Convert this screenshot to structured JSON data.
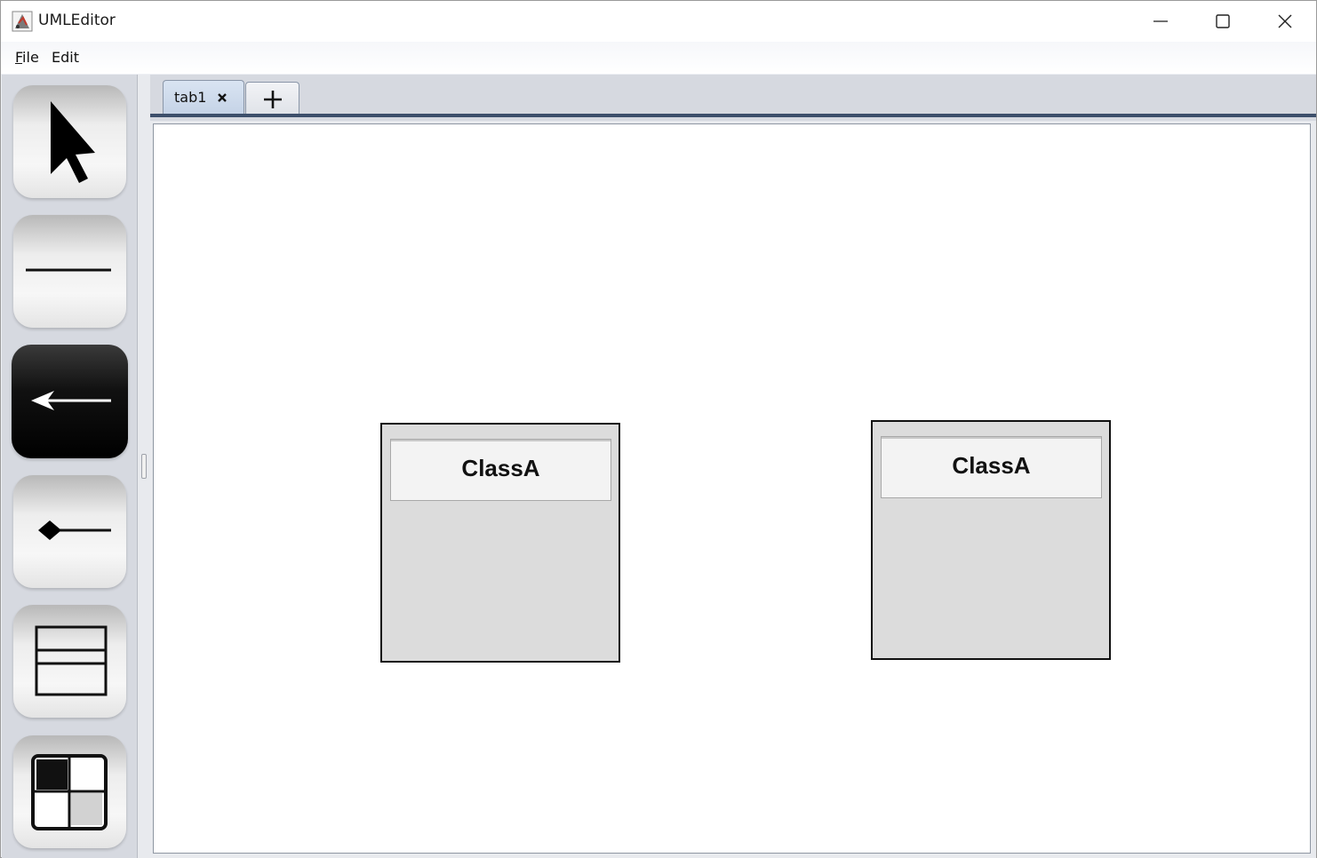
{
  "window": {
    "title": "UMLEditor",
    "controls": [
      {
        "name": "minimize-button",
        "icon": "minimize-icon"
      },
      {
        "name": "maximize-button",
        "icon": "maximize-icon"
      },
      {
        "name": "close-button",
        "icon": "close-icon"
      }
    ]
  },
  "menubar": {
    "file": {
      "mnemonic": "F",
      "rest": "ile"
    },
    "edit": {
      "label": "Edit"
    }
  },
  "toolbar": {
    "tools": [
      {
        "name": "select-tool",
        "icon": "arrow-cursor-icon",
        "active": false
      },
      {
        "name": "association-line-tool",
        "icon": "line-icon",
        "active": false
      },
      {
        "name": "generalization-line-tool",
        "icon": "arrow-line-icon",
        "active": true
      },
      {
        "name": "composition-line-tool",
        "icon": "diamond-line-icon",
        "active": false
      },
      {
        "name": "class-tool",
        "icon": "class-box-icon",
        "active": false
      },
      {
        "name": "use-case-tool",
        "icon": "grid-box-icon",
        "active": false
      }
    ]
  },
  "tabs": {
    "items": [
      {
        "label": "tab1",
        "close_icon": "close-x-icon"
      }
    ],
    "add_icon": "plus-icon"
  },
  "canvas": {
    "classes": [
      {
        "name": "ClassA"
      },
      {
        "name": "ClassA"
      }
    ]
  },
  "colors": {
    "active_tool": "#000000",
    "class_fill": "#dcdcdc",
    "class_name_field": "#f3f3f3",
    "tab_underline": "#3d4f6b"
  }
}
